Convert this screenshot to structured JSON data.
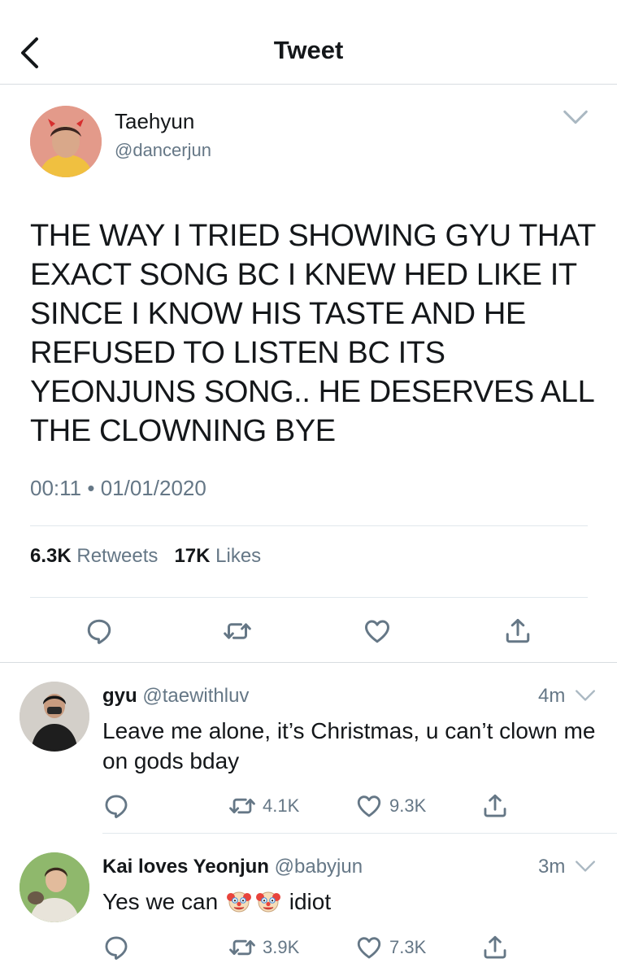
{
  "header": {
    "title": "Tweet"
  },
  "tweet": {
    "author_name": "Taehyun",
    "author_handle": "@dancerjun",
    "text": "THE WAY I TRIED SHOWING GYU THAT EXACT SONG BC I KNEW HED LIKE IT SINCE I KNOW HIS TASTE AND HE REFUSED TO LISTEN BC ITS YEONJUNS SONG.. HE DESERVES ALL THE CLOWNING BYE",
    "time": "00:11",
    "date": "01/01/2020",
    "retweets_count": "6.3K",
    "retweets_label": "Retweets",
    "likes_count": "17K",
    "likes_label": "Likes"
  },
  "replies": [
    {
      "name": "gyu",
      "handle": "@taewithluv",
      "time": "4m",
      "text": "Leave me alone, it’s Christmas, u can’t clown me on gods bday",
      "retweets": "4.1K",
      "likes": "9.3K"
    },
    {
      "name": "Kai loves Yeonjun",
      "handle": "@babyjun",
      "time": "3m",
      "text_before": "Yes we can",
      "text_after": "idiot",
      "emojis": [
        "clown-face-icon",
        "clown-face-icon"
      ],
      "retweets": "3.9K",
      "likes": "7.3K"
    }
  ],
  "colors": {
    "text": "#14171a",
    "muted": "#657786",
    "separator": "#e1e8ed",
    "icon": "#657786"
  }
}
